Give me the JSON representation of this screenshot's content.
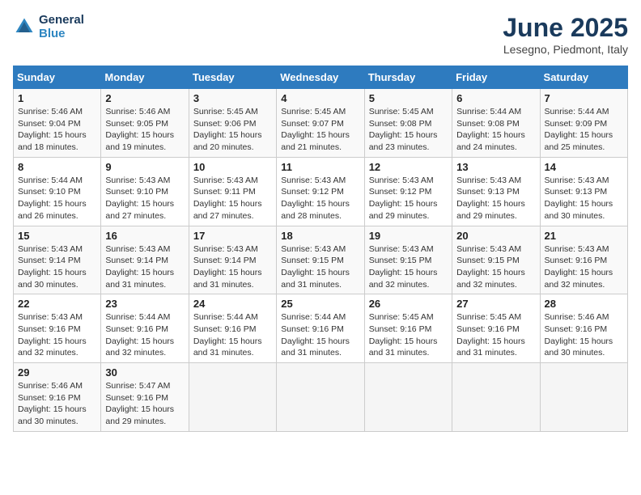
{
  "header": {
    "logo_line1": "General",
    "logo_line2": "Blue",
    "title": "June 2025",
    "subtitle": "Lesegno, Piedmont, Italy"
  },
  "weekdays": [
    "Sunday",
    "Monday",
    "Tuesday",
    "Wednesday",
    "Thursday",
    "Friday",
    "Saturday"
  ],
  "weeks": [
    [
      {
        "day": "1",
        "sunrise": "Sunrise: 5:46 AM",
        "sunset": "Sunset: 9:04 PM",
        "daylight": "Daylight: 15 hours and 18 minutes."
      },
      {
        "day": "2",
        "sunrise": "Sunrise: 5:46 AM",
        "sunset": "Sunset: 9:05 PM",
        "daylight": "Daylight: 15 hours and 19 minutes."
      },
      {
        "day": "3",
        "sunrise": "Sunrise: 5:45 AM",
        "sunset": "Sunset: 9:06 PM",
        "daylight": "Daylight: 15 hours and 20 minutes."
      },
      {
        "day": "4",
        "sunrise": "Sunrise: 5:45 AM",
        "sunset": "Sunset: 9:07 PM",
        "daylight": "Daylight: 15 hours and 21 minutes."
      },
      {
        "day": "5",
        "sunrise": "Sunrise: 5:45 AM",
        "sunset": "Sunset: 9:08 PM",
        "daylight": "Daylight: 15 hours and 23 minutes."
      },
      {
        "day": "6",
        "sunrise": "Sunrise: 5:44 AM",
        "sunset": "Sunset: 9:08 PM",
        "daylight": "Daylight: 15 hours and 24 minutes."
      },
      {
        "day": "7",
        "sunrise": "Sunrise: 5:44 AM",
        "sunset": "Sunset: 9:09 PM",
        "daylight": "Daylight: 15 hours and 25 minutes."
      }
    ],
    [
      {
        "day": "8",
        "sunrise": "Sunrise: 5:44 AM",
        "sunset": "Sunset: 9:10 PM",
        "daylight": "Daylight: 15 hours and 26 minutes."
      },
      {
        "day": "9",
        "sunrise": "Sunrise: 5:43 AM",
        "sunset": "Sunset: 9:10 PM",
        "daylight": "Daylight: 15 hours and 27 minutes."
      },
      {
        "day": "10",
        "sunrise": "Sunrise: 5:43 AM",
        "sunset": "Sunset: 9:11 PM",
        "daylight": "Daylight: 15 hours and 27 minutes."
      },
      {
        "day": "11",
        "sunrise": "Sunrise: 5:43 AM",
        "sunset": "Sunset: 9:12 PM",
        "daylight": "Daylight: 15 hours and 28 minutes."
      },
      {
        "day": "12",
        "sunrise": "Sunrise: 5:43 AM",
        "sunset": "Sunset: 9:12 PM",
        "daylight": "Daylight: 15 hours and 29 minutes."
      },
      {
        "day": "13",
        "sunrise": "Sunrise: 5:43 AM",
        "sunset": "Sunset: 9:13 PM",
        "daylight": "Daylight: 15 hours and 29 minutes."
      },
      {
        "day": "14",
        "sunrise": "Sunrise: 5:43 AM",
        "sunset": "Sunset: 9:13 PM",
        "daylight": "Daylight: 15 hours and 30 minutes."
      }
    ],
    [
      {
        "day": "15",
        "sunrise": "Sunrise: 5:43 AM",
        "sunset": "Sunset: 9:14 PM",
        "daylight": "Daylight: 15 hours and 30 minutes."
      },
      {
        "day": "16",
        "sunrise": "Sunrise: 5:43 AM",
        "sunset": "Sunset: 9:14 PM",
        "daylight": "Daylight: 15 hours and 31 minutes."
      },
      {
        "day": "17",
        "sunrise": "Sunrise: 5:43 AM",
        "sunset": "Sunset: 9:14 PM",
        "daylight": "Daylight: 15 hours and 31 minutes."
      },
      {
        "day": "18",
        "sunrise": "Sunrise: 5:43 AM",
        "sunset": "Sunset: 9:15 PM",
        "daylight": "Daylight: 15 hours and 31 minutes."
      },
      {
        "day": "19",
        "sunrise": "Sunrise: 5:43 AM",
        "sunset": "Sunset: 9:15 PM",
        "daylight": "Daylight: 15 hours and 32 minutes."
      },
      {
        "day": "20",
        "sunrise": "Sunrise: 5:43 AM",
        "sunset": "Sunset: 9:15 PM",
        "daylight": "Daylight: 15 hours and 32 minutes."
      },
      {
        "day": "21",
        "sunrise": "Sunrise: 5:43 AM",
        "sunset": "Sunset: 9:16 PM",
        "daylight": "Daylight: 15 hours and 32 minutes."
      }
    ],
    [
      {
        "day": "22",
        "sunrise": "Sunrise: 5:43 AM",
        "sunset": "Sunset: 9:16 PM",
        "daylight": "Daylight: 15 hours and 32 minutes."
      },
      {
        "day": "23",
        "sunrise": "Sunrise: 5:44 AM",
        "sunset": "Sunset: 9:16 PM",
        "daylight": "Daylight: 15 hours and 32 minutes."
      },
      {
        "day": "24",
        "sunrise": "Sunrise: 5:44 AM",
        "sunset": "Sunset: 9:16 PM",
        "daylight": "Daylight: 15 hours and 31 minutes."
      },
      {
        "day": "25",
        "sunrise": "Sunrise: 5:44 AM",
        "sunset": "Sunset: 9:16 PM",
        "daylight": "Daylight: 15 hours and 31 minutes."
      },
      {
        "day": "26",
        "sunrise": "Sunrise: 5:45 AM",
        "sunset": "Sunset: 9:16 PM",
        "daylight": "Daylight: 15 hours and 31 minutes."
      },
      {
        "day": "27",
        "sunrise": "Sunrise: 5:45 AM",
        "sunset": "Sunset: 9:16 PM",
        "daylight": "Daylight: 15 hours and 31 minutes."
      },
      {
        "day": "28",
        "sunrise": "Sunrise: 5:46 AM",
        "sunset": "Sunset: 9:16 PM",
        "daylight": "Daylight: 15 hours and 30 minutes."
      }
    ],
    [
      {
        "day": "29",
        "sunrise": "Sunrise: 5:46 AM",
        "sunset": "Sunset: 9:16 PM",
        "daylight": "Daylight: 15 hours and 30 minutes."
      },
      {
        "day": "30",
        "sunrise": "Sunrise: 5:47 AM",
        "sunset": "Sunset: 9:16 PM",
        "daylight": "Daylight: 15 hours and 29 minutes."
      },
      null,
      null,
      null,
      null,
      null
    ]
  ]
}
